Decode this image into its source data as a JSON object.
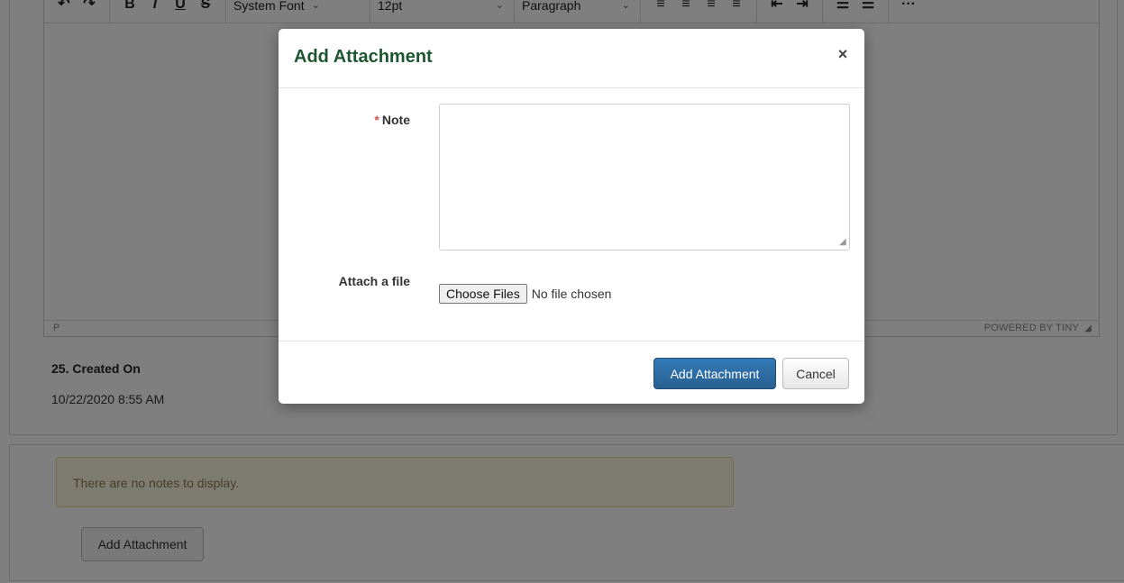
{
  "editor": {
    "toolbar": {
      "undo_redo": [
        "↶",
        "↷"
      ],
      "format_buttons": [
        "B",
        "I",
        "U",
        "S"
      ],
      "font_select": "System Font",
      "size_select": "12pt",
      "block_select": "Paragraph",
      "chevron": "⌄",
      "align_buttons": [
        "≡",
        "≡",
        "≡",
        "≡"
      ],
      "indent_buttons": [
        "⇤",
        "⇥"
      ],
      "list_buttons": [
        "☰",
        "☰"
      ],
      "more": "···"
    },
    "status_path": "P",
    "powered_by": "POWERED BY TINY"
  },
  "created_on": {
    "label": "25. Created On",
    "value": "10/22/2020 8:55 AM"
  },
  "notes": {
    "empty_message": "There are no notes to display.",
    "add_button": "Add Attachment"
  },
  "modal": {
    "title": "Add Attachment",
    "close_symbol": "×",
    "note_label": "Note",
    "required_marker": "*",
    "note_value": "",
    "file_label": "Attach a file",
    "choose_button": "Choose Files",
    "no_file_text": "No file chosen",
    "submit_button": "Add Attachment",
    "cancel_button": "Cancel"
  },
  "colors": {
    "title": "#1e5631",
    "primary": "#337ab7",
    "alert_bg": "#fcf8e3",
    "required": "#d9534f"
  }
}
